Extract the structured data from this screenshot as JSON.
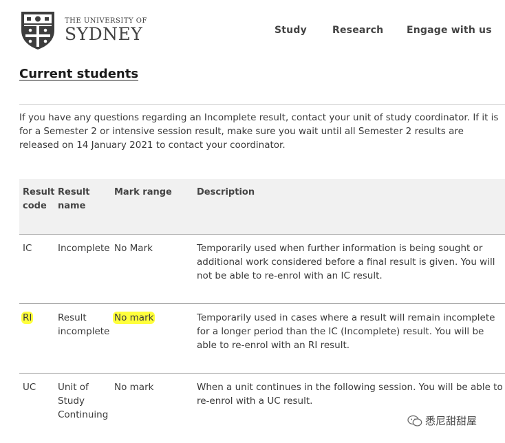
{
  "header": {
    "logo_small": "THE UNIVERSITY OF",
    "logo_big": "SYDNEY",
    "nav": [
      "Study",
      "Research",
      "Engage with us"
    ]
  },
  "section_title": "Current students",
  "intro": "If you have any questions regarding an Incomplete result, contact your unit of study coordinator. If it is for a Semester 2 or intensive session result, make sure you wait until all Semester 2 results are released on 14 January 2021 to contact your coordinator.",
  "table": {
    "headers": [
      "Result code",
      "Result name",
      "Mark range",
      "Description"
    ],
    "rows": [
      {
        "code": "IC",
        "name": "Incomplete",
        "range": "No Mark",
        "description": "Temporarily used when further information is being sought or additional work considered before a final result is given. You will not be able to re-enrol with an IC result."
      },
      {
        "code": "RI",
        "name": "Result incomplete",
        "range": "No mark",
        "description": "Temporarily used in cases where a result will remain incomplete for a longer period than the IC (Incomplete) result. You will be able to re-enrol with an RI result."
      },
      {
        "code": "UC",
        "name": "Unit of Study Continuing",
        "range": "No mark",
        "description": "When a unit continues in the following session. You will be able to re-enrol with a UC result."
      }
    ]
  },
  "highlight_color": "#ffff3c",
  "watermark": "悉尼甜甜屋"
}
